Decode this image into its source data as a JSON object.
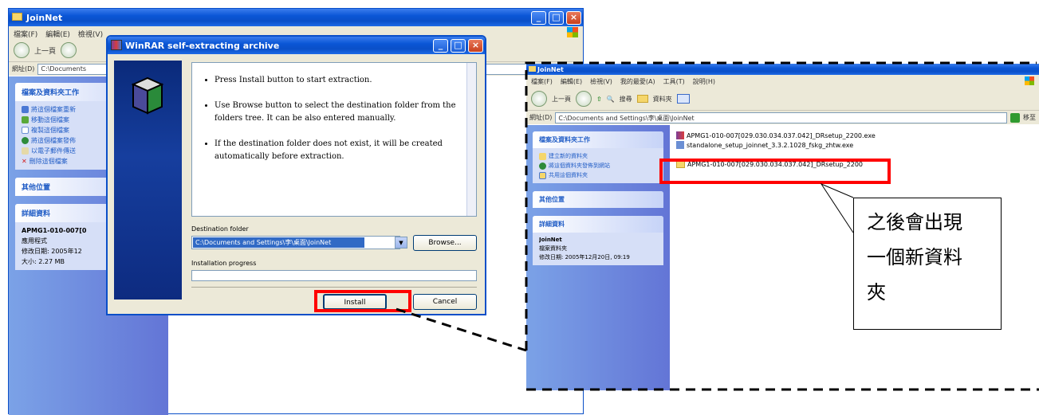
{
  "left_window": {
    "title": "JoinNet",
    "menu": [
      "檔案(F)",
      "編輯(E)",
      "檢視(V)"
    ],
    "toolbar_back": "上一頁",
    "address_label": "網址(D)",
    "address_value": "C:\\Documents",
    "task_header": "檔案及資料夾工作",
    "tasks": [
      "將這個檔案重新",
      "移動這個檔案",
      "複製這個檔案",
      "將這個檔案發佈",
      "以電子郵件傳送",
      "刪除這個檔案"
    ],
    "other_header": "其他位置",
    "details_header": "詳細資料",
    "details_name": "APMG1-010-007[0",
    "details_type": "應用程式",
    "details_date": "修改日期: 2005年12",
    "details_size": "大小: 2.27 MB"
  },
  "winrar": {
    "title": "WinRAR self-extracting archive",
    "bullets": [
      "Press Install button to start extraction.",
      "Use Browse button to select the destination folder from the folders tree. It can be also entered manually.",
      "If the destination folder does not exist, it will be created automatically before extraction."
    ],
    "dest_label": "Destination folder",
    "dest_value": "C:\\Documents and Settings\\李\\桌面\\JoinNet",
    "browse_label": "Browse...",
    "progress_label": "Installation progress",
    "install_label": "Install",
    "cancel_label": "Cancel"
  },
  "right_window": {
    "title": "JoinNet",
    "menu": [
      "檔案(F)",
      "編輯(E)",
      "檢視(V)",
      "我的最愛(A)",
      "工具(T)",
      "說明(H)"
    ],
    "toolbar_back": "上一頁",
    "toolbar_search": "搜尋",
    "toolbar_folders": "資料夾",
    "address_label": "網址(D)",
    "address_value": "C:\\Documents and Settings\\李\\桌面\\JoinNet",
    "go_label": "移至",
    "task_header": "檔案及資料夾工作",
    "tasks": [
      "建立新的資料夾",
      "將這個資料夾發佈到網站",
      "共用這個資料夾"
    ],
    "other_header": "其他位置",
    "details_header": "詳細資料",
    "details_name": "JoinNet",
    "details_type": "檔案資料夾",
    "details_date": "修改日期: 2005年12月20日, 09:19",
    "files": [
      "APMG1-010-007[029.030.034.037.042]_DRsetup_2200.exe",
      "standalone_setup_joinnet_3.3.2.1028_fskg_zhtw.exe",
      "APMG1-010-007[029.030.034.037.042]_DRsetup_2200"
    ],
    "callout": [
      "之後會出現",
      "一個新資料",
      "夾"
    ]
  },
  "colors": {
    "highlight": "#ff0000",
    "xp_blue": "#0a56d6",
    "task_pane": "#6f8fe0"
  }
}
